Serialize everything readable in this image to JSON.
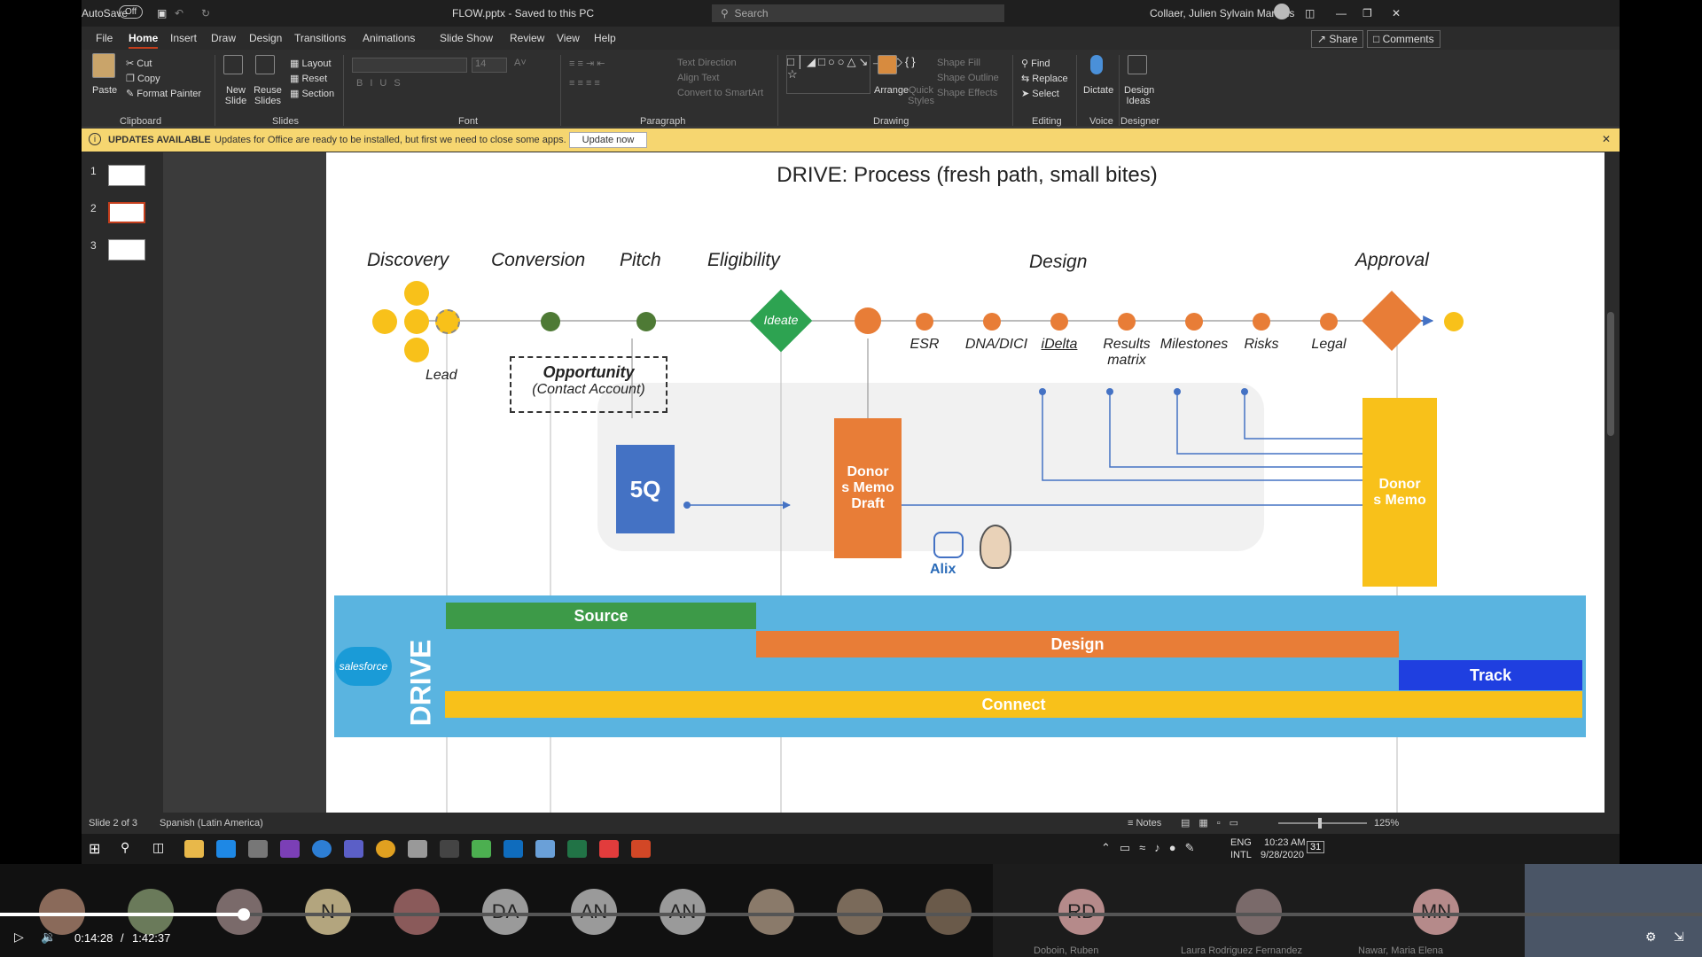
{
  "titlebar": {
    "autosave": "AutoSave",
    "autosave_state": "Off",
    "filename": "FLOW.pptx  -  Saved to this PC",
    "search_placeholder": "Search",
    "user": "Collaer, Julien Sylvain Marinus"
  },
  "menu": {
    "tabs": [
      "File",
      "Home",
      "Insert",
      "Draw",
      "Design",
      "Transitions",
      "Animations",
      "Slide Show",
      "Review",
      "View",
      "Help"
    ],
    "share": "Share",
    "comments": "Comments"
  },
  "ribbon": {
    "paste": "Paste",
    "cut": "Cut",
    "copy": "Copy",
    "format_painter": "Format Painter",
    "clipboard": "Clipboard",
    "new_slide": "New Slide",
    "reuse_slides": "Reuse Slides",
    "layout": "Layout",
    "reset": "Reset",
    "section": "Section",
    "slides": "Slides",
    "font_size": "14",
    "font": "Font",
    "text_direction": "Text Direction",
    "align_text": "Align Text",
    "convert_smartart": "Convert to SmartArt",
    "paragraph": "Paragraph",
    "arrange": "Arrange",
    "quick_styles": "Quick Styles",
    "shape_fill": "Shape Fill",
    "shape_outline": "Shape Outline",
    "shape_effects": "Shape Effects",
    "drawing": "Drawing",
    "find": "Find",
    "replace": "Replace",
    "select": "Select",
    "editing": "Editing",
    "dictate": "Dictate",
    "voice": "Voice",
    "design_ideas": "Design Ideas",
    "designer": "Designer"
  },
  "update_bar": {
    "title": "UPDATES AVAILABLE",
    "message": "Updates for Office are ready to be installed, but first we need to close some apps.",
    "button": "Update now"
  },
  "thumbnails": [
    "1",
    "2",
    "3"
  ],
  "slide": {
    "title": "DRIVE: Process (fresh path, small bites)",
    "stages": {
      "discovery": "Discovery",
      "conversion": "Conversion",
      "pitch": "Pitch",
      "eligibility": "Eligibility",
      "design": "Design",
      "approval": "Approval"
    },
    "lead": "Lead",
    "opportunity": "Opportunity",
    "contact_account": "(Contact Account)",
    "ideate": "Ideate",
    "steps": [
      "ESR",
      "DNA/DICI",
      "iDelta",
      "Results matrix",
      "Milestones",
      "Risks",
      "Legal"
    ],
    "five_q": "5Q",
    "donors_memo_draft": "Donor s Memo Draft",
    "donors_memo": "Donor s Memo",
    "alix": "Alix",
    "drive": "DRIVE",
    "salesforce": "salesforce",
    "bars": {
      "source": "Source",
      "design": "Design",
      "track": "Track",
      "connect": "Connect"
    },
    "colors": {
      "yellow": "#f8c11a",
      "green": "#3d9a48",
      "orange": "#e87d37",
      "blue": "#4472c4",
      "band": "#5ab4e0",
      "track": "#1f3fe0"
    }
  },
  "status": {
    "slide_count": "Slide 2 of 3",
    "language": "Spanish (Latin America)",
    "notes": "Notes",
    "zoom": "125%"
  },
  "taskbar": {
    "lang": "ENG",
    "intl": "INTL",
    "time": "10:23 AM",
    "date": "9/28/2020",
    "notif": "31"
  },
  "meeting": {
    "initials": [
      "N",
      "DA",
      "AN",
      "AN",
      "RD",
      "MN"
    ],
    "names": [
      "Doboin, Ruben",
      "Laura Rodriguez Fernandez",
      "Nawar, Maria Elena"
    ],
    "time": "0:14:28",
    "separator": "/",
    "duration": "1:42:37",
    "progress": 0.143
  }
}
